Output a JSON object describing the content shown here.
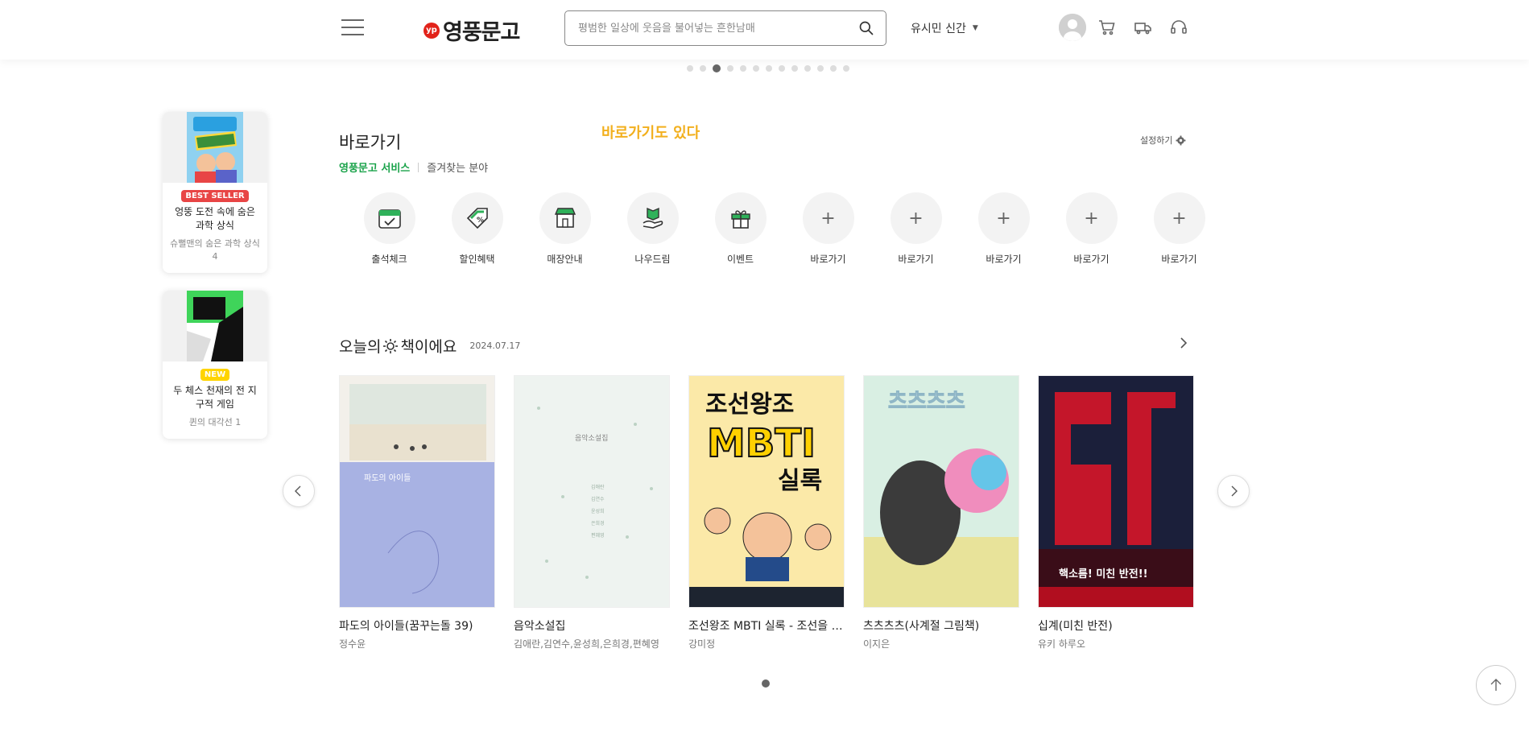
{
  "header": {
    "logo_badge": "yp",
    "logo_text": "영풍문고",
    "search_placeholder": "평범한 일상에 웃음을 불어넣는 흔한남매",
    "category_label": "유시민 신간",
    "icons": [
      "menu-icon",
      "search-icon",
      "user-icon",
      "cart-icon",
      "delivery-icon",
      "headset-icon"
    ]
  },
  "top_pager": {
    "count": 13,
    "active_index": 2
  },
  "promos": [
    {
      "badge": "BEST SELLER",
      "badge_bg": "#e84545",
      "badge_color": "#ffffff",
      "title": "엉뚱 도전 속에 숨은 과학 상식",
      "sub": "슈뻘맨의 숨은 과학 상식 4"
    },
    {
      "badge": "NEW",
      "badge_bg": "#ffd400",
      "badge_color": "#ffffff",
      "title": "두 체스 천재의 전 지구적 게임",
      "sub": "퀸의 대각선 1"
    }
  ],
  "shortcut_section": {
    "title": "바로가기",
    "overlay_note": "바로가기도 있다",
    "tab_active": "영풍문고 서비스",
    "tab_other": "즐겨찾는 분야",
    "settings_label": "설정하기",
    "items": [
      {
        "label": "출석체크",
        "icon": "calendar-check-icon"
      },
      {
        "label": "할인혜택",
        "icon": "discount-tag-icon"
      },
      {
        "label": "매장안내",
        "icon": "store-icon"
      },
      {
        "label": "나우드림",
        "icon": "book-hand-icon"
      },
      {
        "label": "이벤트",
        "icon": "gift-icon"
      },
      {
        "label": "바로가기",
        "icon": "plus-icon"
      },
      {
        "label": "바로가기",
        "icon": "plus-icon"
      },
      {
        "label": "바로가기",
        "icon": "plus-icon"
      },
      {
        "label": "바로가기",
        "icon": "plus-icon"
      },
      {
        "label": "바로가기",
        "icon": "plus-icon"
      }
    ]
  },
  "today": {
    "title_prefix": "오늘의",
    "title_suffix": "책이에요",
    "date": "2024.07.17",
    "books": [
      {
        "title": "파도의 아이들(꿈꾸는돌 39)",
        "author": "정수윤",
        "cover_text": "파도의 아이들"
      },
      {
        "title": "음악소설집",
        "author": "김애란,김연수,윤성희,은희경,편혜영",
        "cover_text": "음악소설집"
      },
      {
        "title": "조선왕조 MBTI 실록 - 조선을 이...",
        "author": "강미정",
        "cover_text": "조선왕조 MBTI 실록"
      },
      {
        "title": "츠츠츠츠(사계절 그림책)",
        "author": "이지은",
        "cover_text": "츠츠츠츠"
      },
      {
        "title": "십계(미친 반전)",
        "author": "유키 하루오",
        "cover_text": "핵소름! 미친 반전!!"
      }
    ]
  },
  "colors": {
    "accent_green": "#1aa34a",
    "note_yellow": "#f2b01e",
    "logo_red": "#e2231a"
  }
}
